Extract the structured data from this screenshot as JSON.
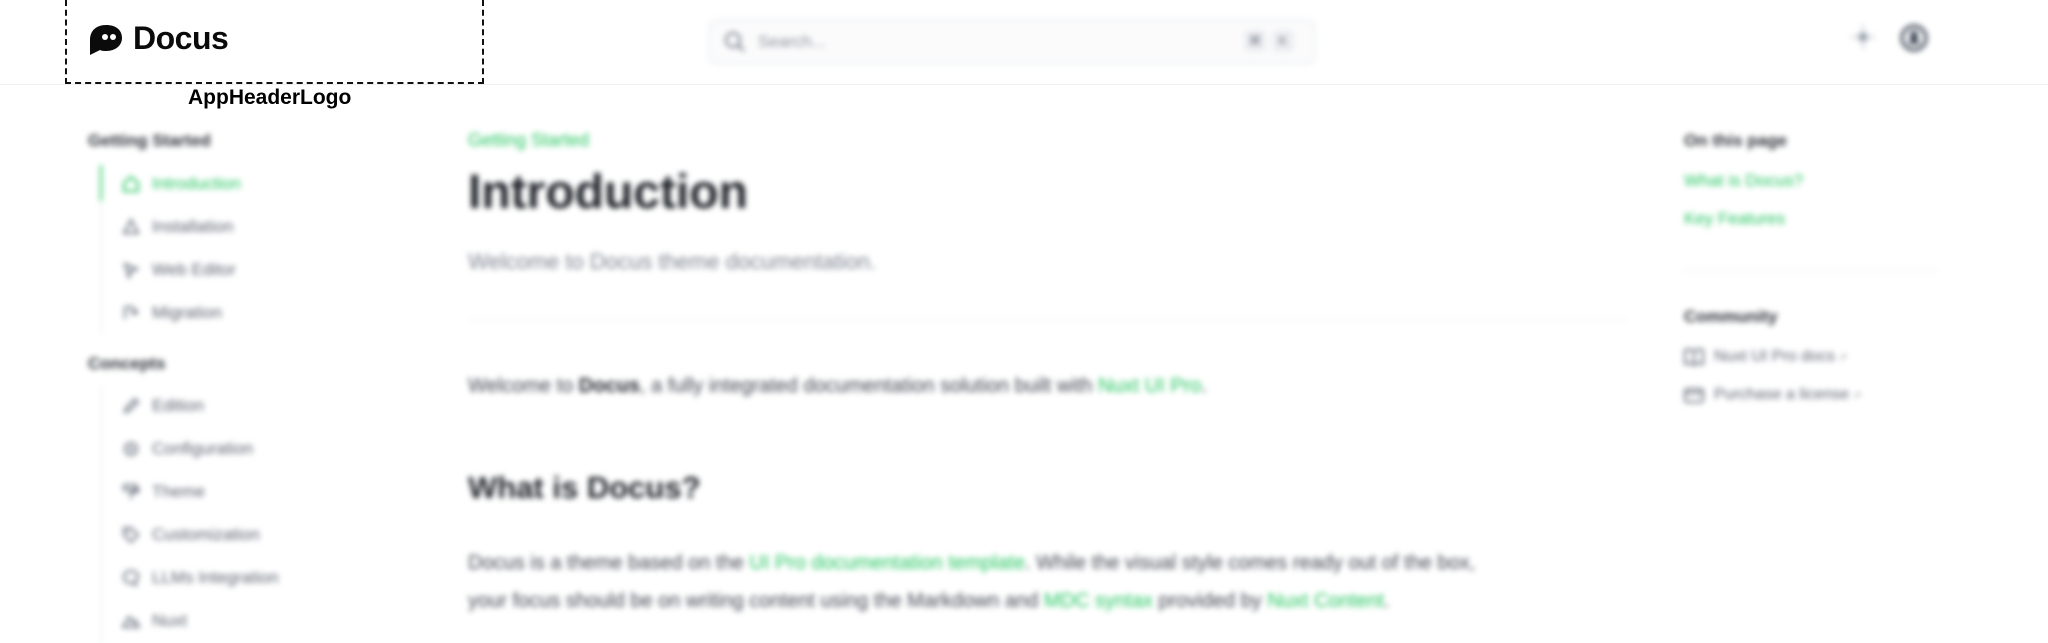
{
  "header": {
    "logo_text": "Docus",
    "logo_caption": "AppHeaderLogo",
    "search_placeholder": "Search...",
    "shortcut_keys": [
      "⌘",
      "K"
    ],
    "theme_icon": "sun-icon",
    "github_icon": "github-icon"
  },
  "sidebar": {
    "sections": [
      {
        "heading": "Getting Started",
        "items": [
          {
            "label": "Introduction",
            "icon": "house-icon",
            "active": true
          },
          {
            "label": "Installation",
            "icon": "warning-triangle-icon",
            "active": false
          },
          {
            "label": "Web Editor",
            "icon": "cursor-icon",
            "active": false
          },
          {
            "label": "Migration",
            "icon": "migrate-icon",
            "active": false
          }
        ]
      },
      {
        "heading": "Concepts",
        "items": [
          {
            "label": "Edition",
            "icon": "pencil-icon",
            "active": false
          },
          {
            "label": "Configuration",
            "icon": "gear-icon",
            "active": false
          },
          {
            "label": "Theme",
            "icon": "paint-roller-icon",
            "active": false
          },
          {
            "label": "Customization",
            "icon": "tag-icon",
            "active": false
          },
          {
            "label": "LLMs Integration",
            "icon": "chat-icon",
            "active": false
          },
          {
            "label": "Nuxt",
            "icon": "mountain-icon",
            "active": false
          }
        ]
      }
    ]
  },
  "main": {
    "breadcrumb": "Getting Started",
    "title": "Introduction",
    "subtitle": "Welcome to Docus theme documentation.",
    "intro": {
      "prefix": "Welcome to ",
      "bold": "Docus",
      "middle": ", a fully integrated documentation solution built with ",
      "link": "Nuxt UI Pro",
      "suffix": "."
    },
    "h2": "What is Docus?",
    "body": {
      "part1": "Docus is a theme based on the ",
      "link1": "UI Pro documentation template",
      "part2": ". While the visual style comes ready out of the box,",
      "part3": "your focus should be on writing content using the Markdown and ",
      "link2": "MDC syntax",
      "part4": " provided by ",
      "link3": "Nuxt Content",
      "part5": "."
    }
  },
  "toc": {
    "heading": "On this page",
    "links": [
      "What is Docus?",
      "Key Features"
    ],
    "community_heading": "Community",
    "community": [
      {
        "label": "Nuxt UI Pro docs",
        "icon": "book-icon"
      },
      {
        "label": "Purchase a license",
        "icon": "credit-card-icon"
      }
    ]
  },
  "colors": {
    "accent": "#22c55e",
    "text": "#1f2329",
    "muted": "#5b6170"
  }
}
